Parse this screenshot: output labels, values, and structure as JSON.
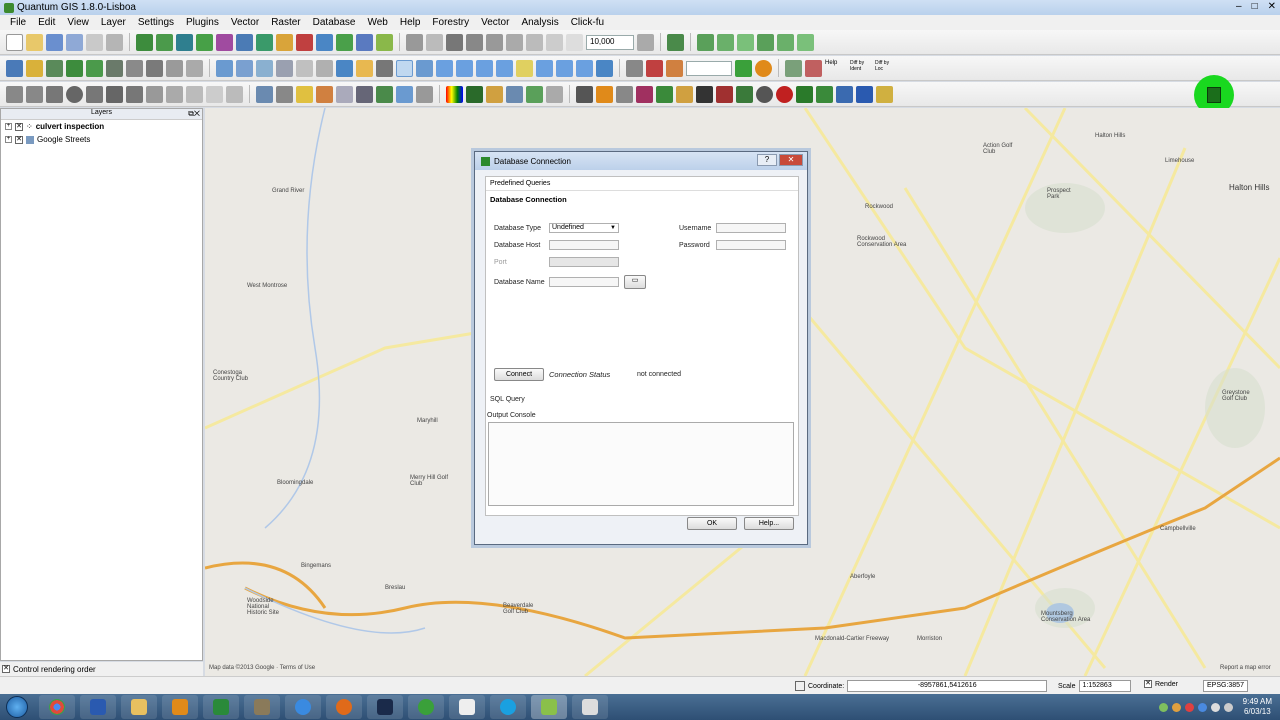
{
  "window": {
    "title": "Quantum GIS 1.8.0-Lisboa",
    "controls": [
      "–",
      "□",
      "✕"
    ]
  },
  "menu": [
    "File",
    "Edit",
    "View",
    "Layer",
    "Settings",
    "Plugins",
    "Vector",
    "Raster",
    "Database",
    "Web",
    "Help",
    "Forestry",
    "Vector",
    "Analysis",
    "Click-fu"
  ],
  "toolbar": {
    "scale_box": "10,000",
    "plugin_labels": [
      "Help",
      "Diff by Ident",
      "Diff by Loc"
    ]
  },
  "layers_panel": {
    "title": "Layers",
    "items": [
      {
        "name": "culvert inspection",
        "checked": true,
        "bold": true
      },
      {
        "name": "Google Streets",
        "checked": true,
        "bold": false
      }
    ],
    "control_rendering": "Control rendering order"
  },
  "dialog": {
    "title": "Database Connection",
    "predefined_queries": "Predefined Queries",
    "section_title": "Database Connection",
    "database_type_label": "Database Type",
    "database_type_value": "Undefined",
    "database_host_label": "Database Host",
    "port_label": "Port",
    "database_name_label": "Database Name",
    "username_label": "Username",
    "password_label": "Password",
    "connect_button": "Connect",
    "connection_status_label": "Connection Status",
    "connection_status_value": "not connected",
    "sql_query": "SQL Query",
    "output_console": "Output Console",
    "ok_button": "OK",
    "help_button": "Help..."
  },
  "map": {
    "labels": [
      "Grand River",
      "West Montrose",
      "Conestoga Country Club",
      "Bloomingdale",
      "Merry Hill Golf Club",
      "Maryhill",
      "Bingemans",
      "Woodside National Historic Site",
      "Breslau",
      "Beaverdale Golf Club",
      "Action Golf Club",
      "Rockwood",
      "Rockwood Conservation Area",
      "Prospect Park",
      "Halton Hills",
      "Limehouse",
      "Halton Hills",
      "Greystone Golf Club",
      "Campbellville",
      "Mountsberg Conservation Area",
      "Aberfoyle",
      "Morriston",
      "Macdonald-Cartier Freeway",
      "Report a map error",
      "Map data ©2013 Google · Terms of Use"
    ]
  },
  "statusbar": {
    "coordinate_label": "Coordinate:",
    "coordinate_value": "-8957861,5412616",
    "scale_label": "Scale",
    "scale_value": "1:152863",
    "render_label": "Render",
    "epsg": "EPSG:3857"
  },
  "taskbar": {
    "time": "9:49 AM",
    "date": "6/03/13"
  }
}
